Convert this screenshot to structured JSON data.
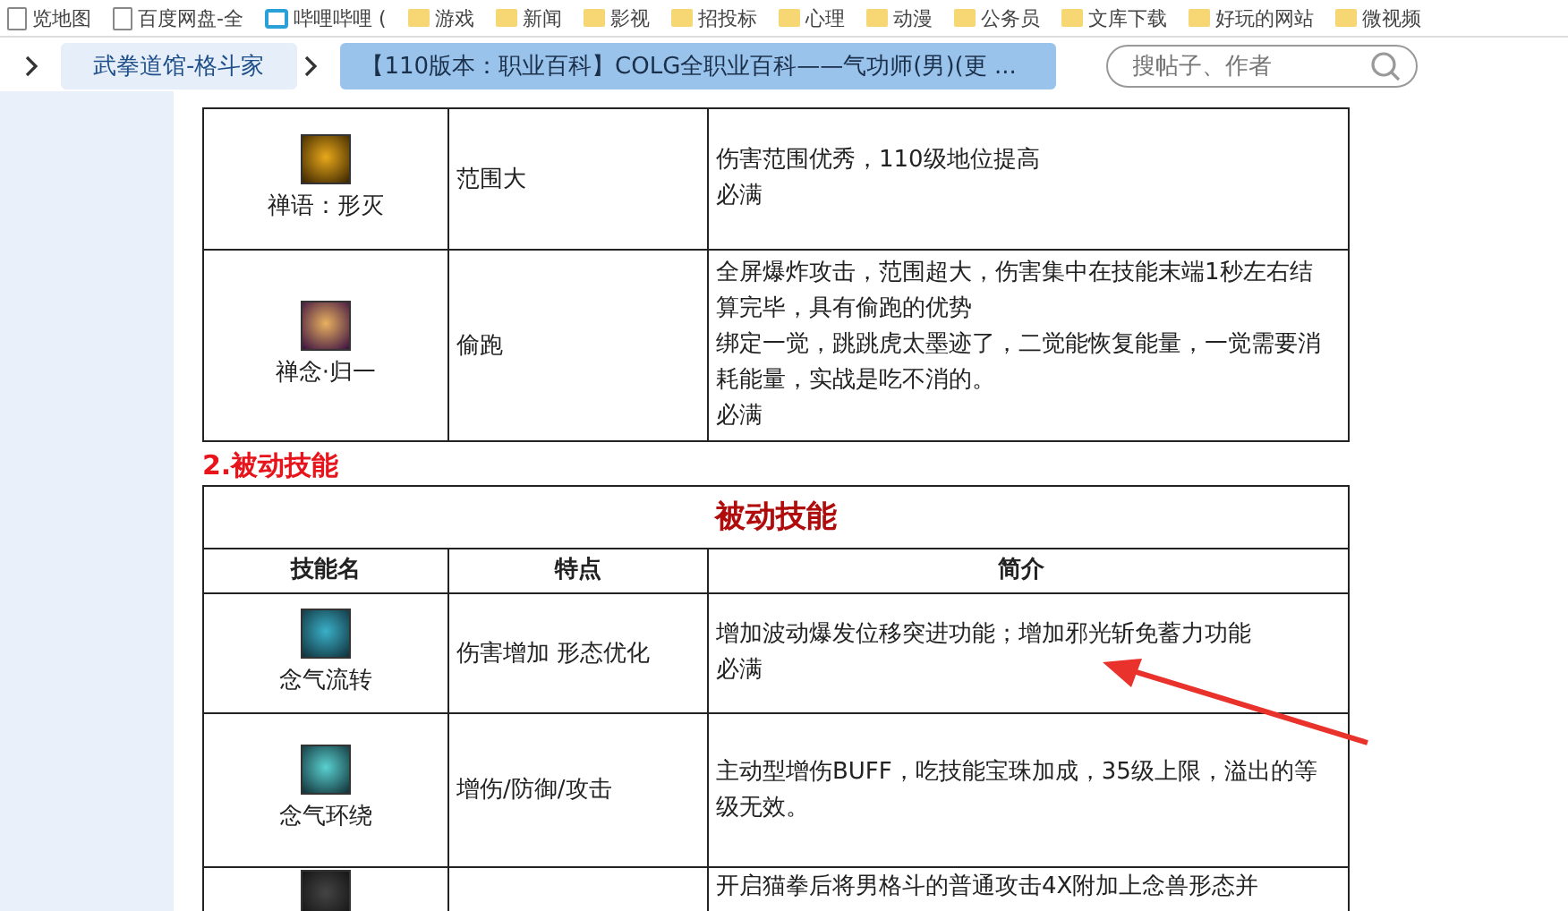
{
  "bookmarks": [
    {
      "label": "览地图",
      "kind": "page"
    },
    {
      "label": "百度网盘-全",
      "kind": "page"
    },
    {
      "label": "哔哩哔哩 (",
      "kind": "app"
    },
    {
      "label": "游戏",
      "kind": "folder"
    },
    {
      "label": "新闻",
      "kind": "folder"
    },
    {
      "label": "影视",
      "kind": "folder"
    },
    {
      "label": "招投标",
      "kind": "folder"
    },
    {
      "label": "心理",
      "kind": "folder"
    },
    {
      "label": "动漫",
      "kind": "folder"
    },
    {
      "label": "公务员",
      "kind": "folder"
    },
    {
      "label": "文库下载",
      "kind": "folder"
    },
    {
      "label": "好玩的网站",
      "kind": "folder"
    },
    {
      "label": "微视频",
      "kind": "folder"
    }
  ],
  "breadcrumbs": [
    {
      "label": "武拳道馆-格斗家",
      "selected": false
    },
    {
      "label": "【110版本：职业百科】COLG全职业百科——气功师(男)(更 ...",
      "selected": true
    }
  ],
  "search": {
    "placeholder": "搜帖子、作者"
  },
  "active_table": {
    "rows": [
      {
        "skill": "禅语：形灭",
        "feature": "范围大",
        "desc": [
          "伤害范围优秀，110级地位提高",
          "必满"
        ]
      },
      {
        "skill": "禅念·归一",
        "feature": "偷跑",
        "desc": [
          "全屏爆炸攻击，范围超大，伤害集中在技能末端1秒左右结算完毕，具有偷跑的优势",
          "绑定一觉，跳跳虎太墨迹了，二觉能恢复能量，一觉需要消耗能量，实战是吃不消的。",
          "必满"
        ]
      }
    ]
  },
  "section_heading": "2.被动技能",
  "passive_table": {
    "title": "被动技能",
    "columns": [
      "技能名",
      "特点",
      "简介"
    ],
    "rows": [
      {
        "skill": "念气流转",
        "feature": "伤害增加 形态优化",
        "desc": [
          "增加波动爆发位移突进功能；增加邪光斩免蓄力功能",
          "必满"
        ]
      },
      {
        "skill": "念气环绕",
        "feature": "增伤/防御/攻击",
        "desc": [
          "主动型增伤BUFF，吃技能宝珠加成，35级上限，溢出的等级无效。"
        ]
      },
      {
        "skill": "",
        "feature": "",
        "desc": [
          "开启猫拳后将男格斗的普通攻击4X附加上念兽形态并"
        ]
      }
    ]
  }
}
